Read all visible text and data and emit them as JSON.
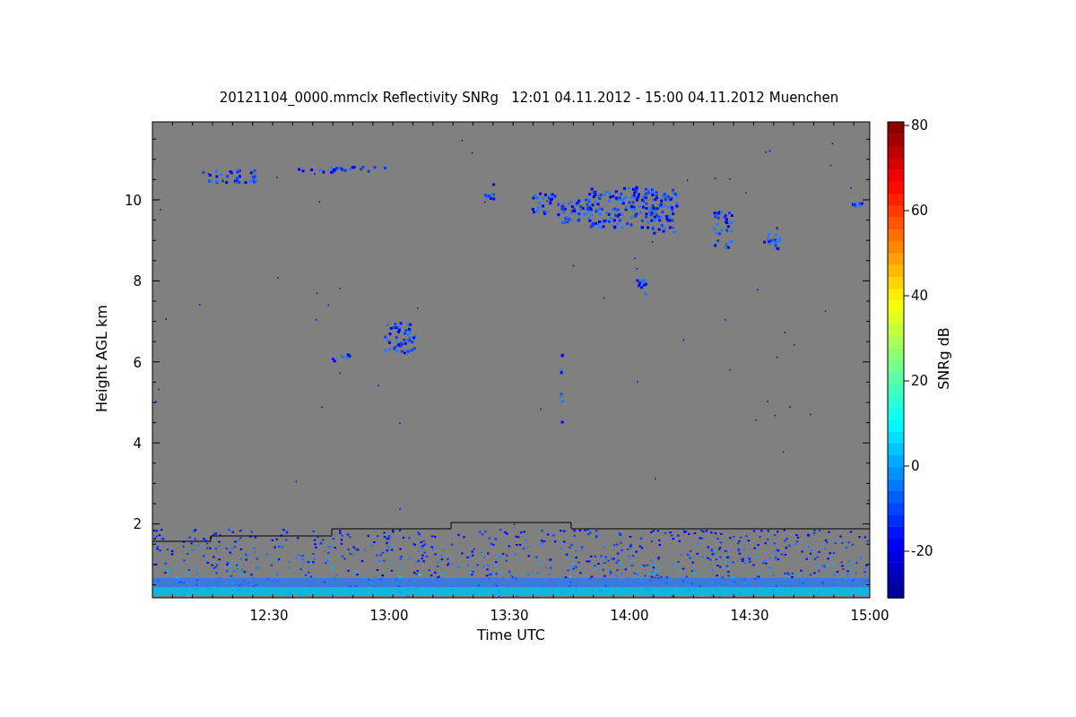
{
  "title": "20121104_0000.mmclx Reflectivity SNRg   12:01 04.11.2012 - 15:00 04.11.2012 Muenchen",
  "x_axis": {
    "label": "Time UTC",
    "ticks": [
      "12:30",
      "13:00",
      "13:30",
      "14:00",
      "14:30",
      "15:00"
    ]
  },
  "y_axis": {
    "label": "Height AGL km",
    "ticks": [
      "10",
      "8",
      "6",
      "4",
      "2"
    ]
  },
  "colorbar": {
    "label": "SNRg dB",
    "ticks": [
      "80",
      "60",
      "40",
      "20",
      "0",
      "-20"
    ]
  }
}
